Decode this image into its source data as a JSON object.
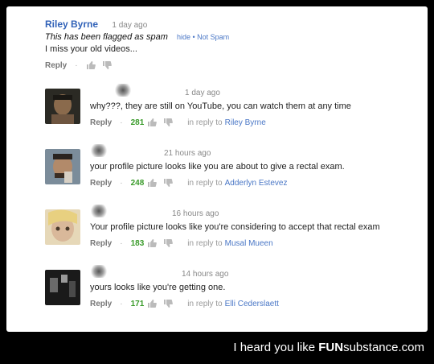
{
  "top_comment": {
    "author": "Riley Byrne",
    "date": "1 day ago",
    "flag_text": "This has been flagged as spam",
    "hide_label": "hide",
    "separator": "•",
    "not_spam_label": "Not Spam",
    "text": "I miss your old videos...",
    "reply_label": "Reply"
  },
  "replies": [
    {
      "date": "1 day ago",
      "text": "why???, they are still on YouTube, you can watch them at any time",
      "reply_label": "Reply",
      "likes": "281",
      "in_reply_prefix": "in reply to",
      "in_reply_to": "Riley Byrne"
    },
    {
      "date": "21 hours ago",
      "text": "your profile picture looks like you are about to give a rectal exam.",
      "reply_label": "Reply",
      "likes": "248",
      "in_reply_prefix": "in reply to",
      "in_reply_to": "Adderlyn Estevez"
    },
    {
      "date": "16 hours ago",
      "text": "Your profile picture looks like you're considering to accept that rectal exam",
      "reply_label": "Reply",
      "likes": "183",
      "in_reply_prefix": "in reply to",
      "in_reply_to": "Musal Mueen"
    },
    {
      "date": "14 hours ago",
      "text": "yours looks like you're getting one.",
      "reply_label": "Reply",
      "likes": "171",
      "in_reply_prefix": "in reply to",
      "in_reply_to": "Elli Cederslaett"
    }
  ],
  "footer": {
    "prefix": "I heard you like ",
    "brand_bold": "FUN",
    "brand_rest": "substance",
    "domain": ".com"
  },
  "colors": {
    "author": "#3162b8",
    "link": "#4a77c6",
    "likes": "#3a9b2a"
  }
}
